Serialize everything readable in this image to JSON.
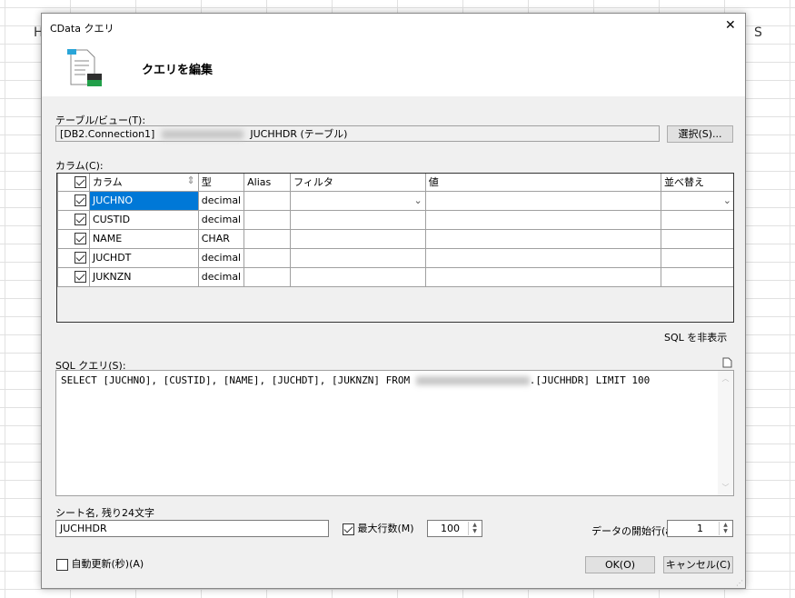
{
  "background": {
    "col_left": "H",
    "col_right": "S"
  },
  "dialog": {
    "title": "CData クエリ",
    "close": "✕",
    "heading": "クエリを編集",
    "table_label": "テーブル/ビュー(T):",
    "table_prefix": "[DB2.Connection1]",
    "table_suffix": "JUCHHDR (テーブル)",
    "select_button": "選択(S)...",
    "columns_label": "カラム(C):",
    "grid_headers": {
      "column": "カラム",
      "type": "型",
      "alias": "Alias",
      "filter": "フィルタ",
      "value": "値",
      "sort": "並べ替え"
    },
    "rows": [
      {
        "name": "JUCHNO",
        "type": "decimal",
        "checked": true
      },
      {
        "name": "CUSTID",
        "type": "decimal",
        "checked": true
      },
      {
        "name": "NAME",
        "type": "CHAR",
        "checked": true
      },
      {
        "name": "JUCHDT",
        "type": "decimal",
        "checked": true
      },
      {
        "name": "JUKNZN",
        "type": "decimal",
        "checked": true
      }
    ],
    "hide_sql": "SQL を非表示",
    "sql_label": "SQL クエリ(S):",
    "sql_prefix": "SELECT [JUCHNO], [CUSTID], [NAME], [JUCHDT], [JUKNZN] FROM ",
    "sql_suffix": ".[JUCHHDR] LIMIT 100",
    "sheet_label": "シート名, 残り24文字",
    "sheet_value": "JUCHHDR",
    "max_rows_label": "最大行数(M)",
    "max_rows_value": "100",
    "start_row_label": "データの開始行(a):",
    "start_row_value": "1",
    "auto_refresh_label": "自動更新(秒)(A)",
    "ok": "OK(O)",
    "cancel": "キャンセル(C)"
  }
}
